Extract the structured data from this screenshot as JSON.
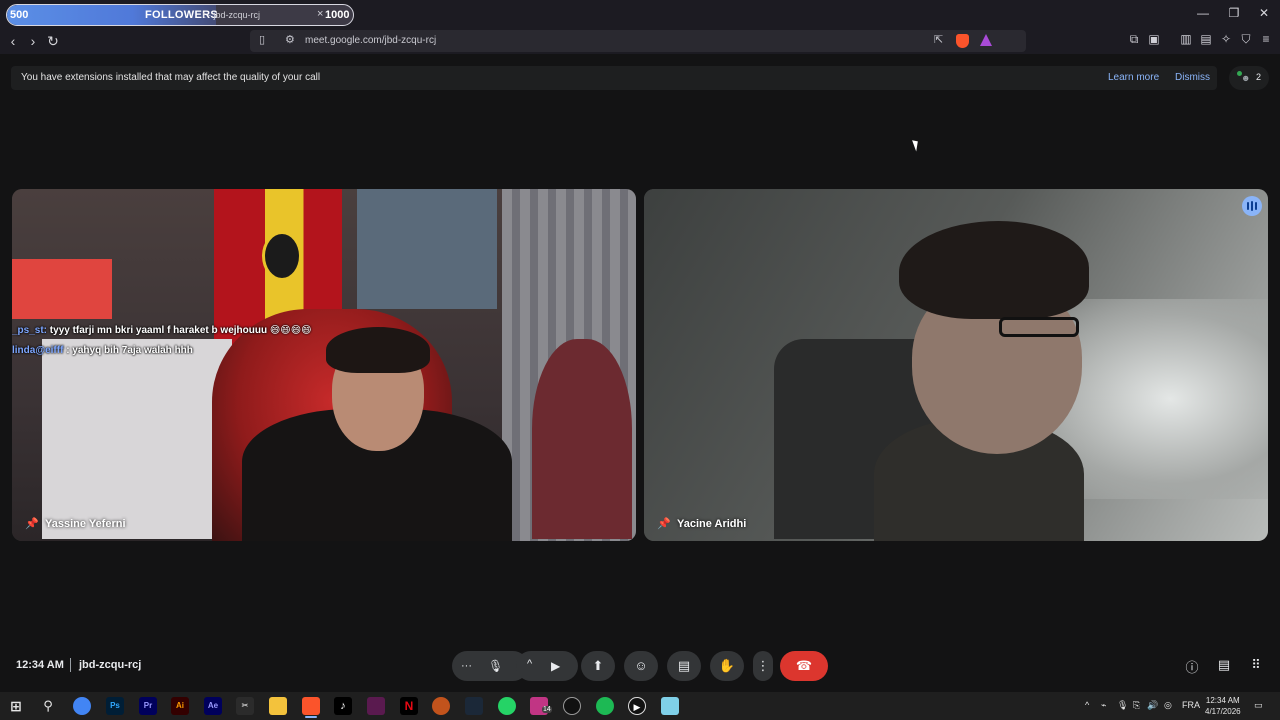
{
  "browser": {
    "tab_title": "t - jbd-zcqu-rcj",
    "tab_close": "×",
    "overlay": {
      "min": "500",
      "label": "FOLLOWERS",
      "max": "1000",
      "progress": 0.6
    },
    "window_controls": {
      "minimize": "—",
      "maximize": "❐",
      "close": "✕"
    },
    "url": "meet.google.com/jbd-zcqu-rcj"
  },
  "banner": {
    "text": "You have extensions installed that may affect the quality of your call",
    "learn_more": "Learn more",
    "dismiss": "Dismiss"
  },
  "people": {
    "count": "2"
  },
  "tiles": [
    {
      "name": "Yassine Yeferni"
    },
    {
      "name": "Yacine Aridhi"
    }
  ],
  "chat_overlay": [
    {
      "user": "_ps_st:",
      "text": "tyyy tfarji mn bkri yaaml f haraket b wejhouuu 😄😄😄😄"
    },
    {
      "user": "linda@eifff",
      "text": ": yahyq bih 7aja walah hhh"
    }
  ],
  "meeting": {
    "time": "12:34 AM",
    "code": "jbd-zcqu-rcj"
  },
  "icons": {
    "more": "···",
    "mic": "🎙",
    "chevron_up": "^",
    "camera": "▶",
    "present": "⬆",
    "emoji": "☺",
    "captions": "▤",
    "hand": "✋",
    "options": "⋮",
    "hangup": "☎",
    "info": "ⓘ",
    "chat": "▤",
    "activities": "⠿"
  },
  "taskbar": {
    "apps": [
      "Ps",
      "Pr",
      "Ai",
      "Ae"
    ],
    "insta_badge": "14",
    "lang": "FRA",
    "time": "12:34 AM",
    "date": "4/17/2026"
  },
  "colors": {
    "accent": "#8ab4f8",
    "hangup": "#dc362e",
    "background": "#131314"
  }
}
